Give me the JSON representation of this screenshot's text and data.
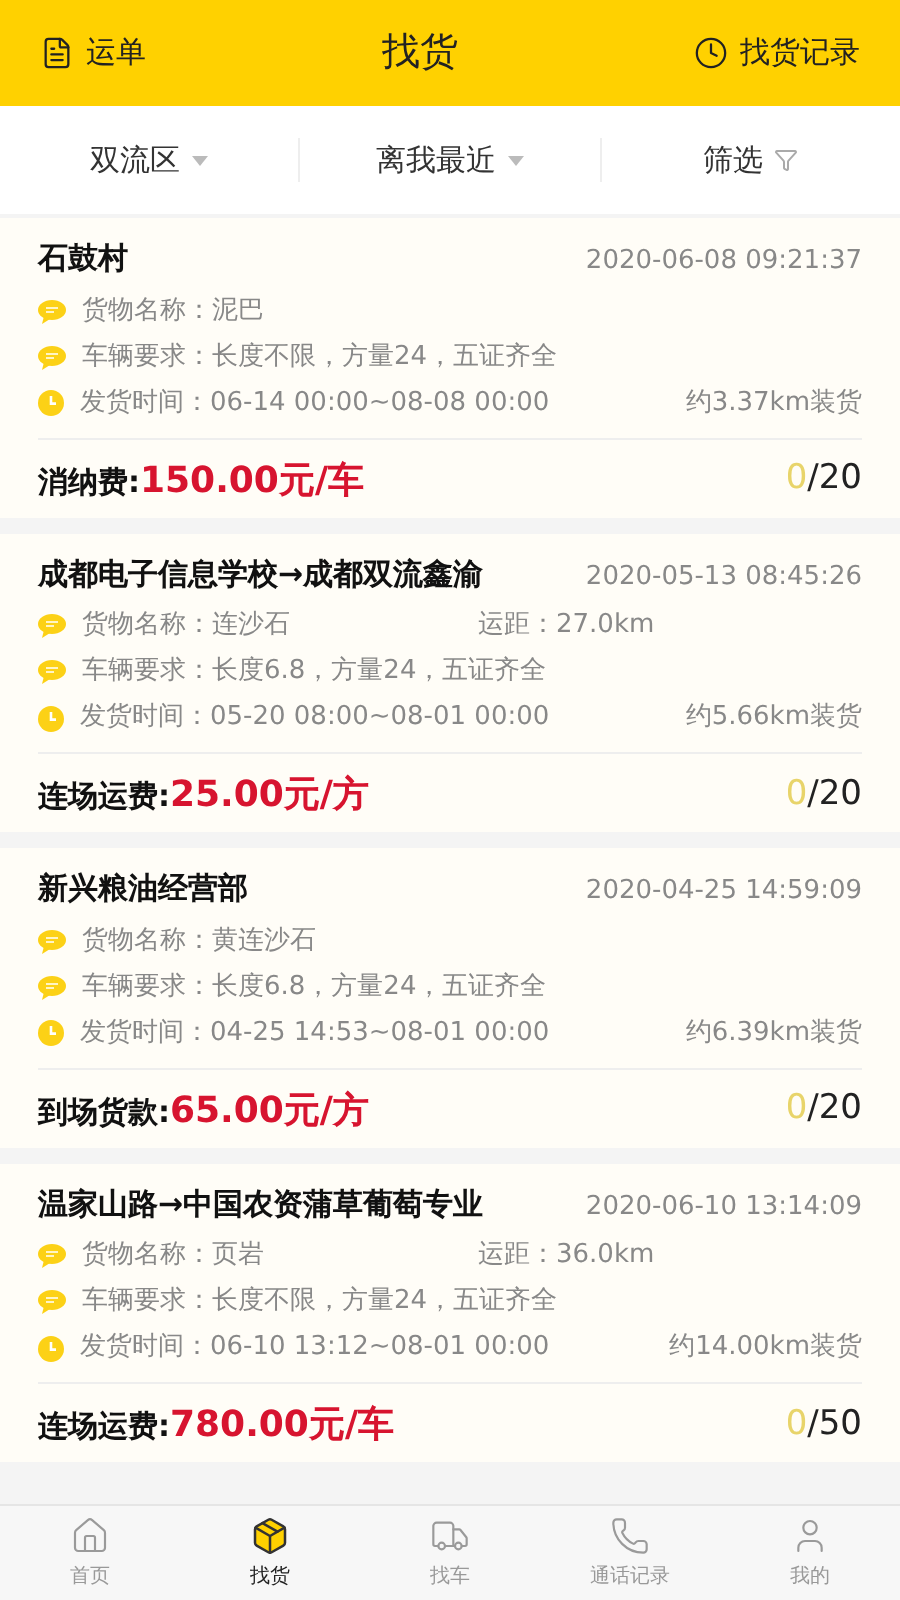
{
  "header": {
    "left": "运单",
    "title": "找货",
    "right": "找货记录"
  },
  "filters": [
    {
      "label": "双流区",
      "kind": "dropdown"
    },
    {
      "label": "离我最近",
      "kind": "dropdown"
    },
    {
      "label": "筛选",
      "kind": "filter"
    }
  ],
  "cards": [
    {
      "title": "石鼓村",
      "time": "2020-06-08 09:21:37",
      "goods": "货物名称：泥巴",
      "vehicle": "车辆要求：长度不限，方量24，五证齐全",
      "ship_time": "发货时间：06-14 00:00~08-08 00:00",
      "pickup": "约3.37km装货",
      "price_label": "消纳费:",
      "price": "150.00元/车",
      "taken": "0",
      "total": "/20"
    },
    {
      "title": "成都电子信息学校→成都双流鑫渝",
      "time": "2020-05-13 08:45:26",
      "goods": "货物名称：连沙石",
      "distance": "运距：27.0km",
      "vehicle": "车辆要求：长度6.8，方量24，五证齐全",
      "ship_time": "发货时间：05-20 08:00~08-01 00:00",
      "pickup": "约5.66km装货",
      "price_label": "连场运费:",
      "price": "25.00元/方",
      "taken": "0",
      "total": "/20"
    },
    {
      "title": "新兴粮油经营部",
      "time": "2020-04-25 14:59:09",
      "goods": "货物名称：黄连沙石",
      "vehicle": "车辆要求：长度6.8，方量24，五证齐全",
      "ship_time": "发货时间：04-25 14:53~08-01 00:00",
      "pickup": "约6.39km装货",
      "price_label": "到场货款:",
      "price": "65.00元/方",
      "taken": "0",
      "total": "/20"
    },
    {
      "title": "温家山路→中国农资蒲草葡萄专业",
      "time": "2020-06-10 13:14:09",
      "goods": "货物名称：页岩",
      "distance": "运距：36.0km",
      "vehicle": "车辆要求：长度不限，方量24，五证齐全",
      "ship_time": "发货时间：06-10 13:12~08-01 00:00",
      "pickup": "约14.00km装货",
      "price_label": "连场运费:",
      "price": "780.00元/车",
      "taken": "0",
      "total": "/50"
    }
  ],
  "tabs": [
    {
      "label": "首页",
      "kind": "home",
      "selected": false
    },
    {
      "label": "找货",
      "kind": "box",
      "selected": true
    },
    {
      "label": "找车",
      "kind": "truck",
      "selected": false
    },
    {
      "label": "通话记录",
      "kind": "phone",
      "selected": false
    },
    {
      "label": "我的",
      "kind": "user",
      "selected": false
    }
  ]
}
